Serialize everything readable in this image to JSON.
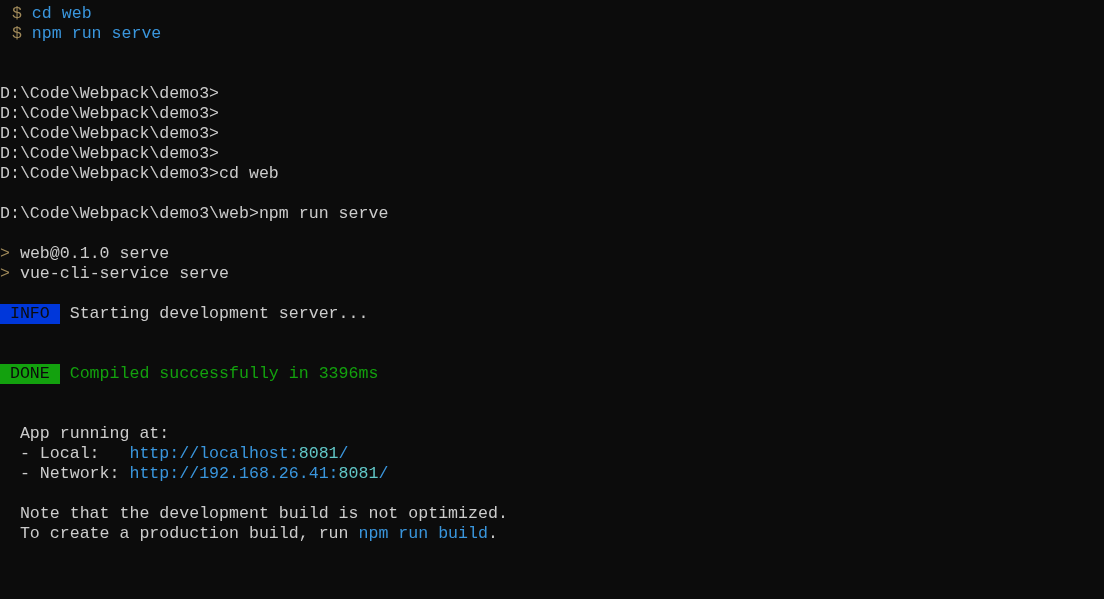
{
  "terminal": {
    "lines": [
      {
        "kind": "echo",
        "segments": [
          {
            "kind": "marker",
            "text": "$"
          },
          {
            "kind": "command",
            "text": "cd web"
          }
        ]
      },
      {
        "kind": "echo",
        "segments": [
          {
            "kind": "marker",
            "text": "$"
          },
          {
            "kind": "command",
            "text": "npm run serve"
          }
        ]
      },
      {
        "kind": "blank"
      },
      {
        "kind": "blank"
      },
      {
        "kind": "output",
        "segments": [
          {
            "kind": "plain",
            "text": "D:\\Code\\Webpack\\demo3>"
          }
        ]
      },
      {
        "kind": "output",
        "segments": [
          {
            "kind": "plain",
            "text": "D:\\Code\\Webpack\\demo3>"
          }
        ]
      },
      {
        "kind": "output",
        "segments": [
          {
            "kind": "plain",
            "text": "D:\\Code\\Webpack\\demo3>"
          }
        ]
      },
      {
        "kind": "output",
        "segments": [
          {
            "kind": "plain",
            "text": "D:\\Code\\Webpack\\demo3>"
          }
        ]
      },
      {
        "kind": "output",
        "segments": [
          {
            "kind": "plain",
            "text": "D:\\Code\\Webpack\\demo3>cd web"
          }
        ]
      },
      {
        "kind": "blank"
      },
      {
        "kind": "output",
        "segments": [
          {
            "kind": "plain",
            "text": "D:\\Code\\Webpack\\demo3\\web>npm run serve"
          }
        ]
      },
      {
        "kind": "blank"
      },
      {
        "kind": "output",
        "segments": [
          {
            "kind": "marker",
            "text": ">"
          },
          {
            "kind": "plain",
            "text": "web@0.1.0 serve"
          }
        ]
      },
      {
        "kind": "output",
        "segments": [
          {
            "kind": "marker",
            "text": ">"
          },
          {
            "kind": "plain",
            "text": "vue-cli-service serve"
          }
        ]
      },
      {
        "kind": "blank"
      },
      {
        "kind": "output",
        "segments": [
          {
            "kind": "info",
            "text": "INFO"
          },
          {
            "kind": "plain",
            "text": "Starting development server..."
          }
        ]
      },
      {
        "kind": "blank"
      },
      {
        "kind": "blank"
      },
      {
        "kind": "output",
        "segments": [
          {
            "kind": "done",
            "text": "DONE"
          },
          {
            "kind": "success",
            "text": "Compiled successfully in 3396ms"
          }
        ]
      },
      {
        "kind": "blank"
      },
      {
        "kind": "blank"
      },
      {
        "kind": "indented",
        "segments": [
          {
            "kind": "plain",
            "text": "App running at:"
          }
        ]
      },
      {
        "kind": "indented",
        "segments": [
          {
            "kind": "label",
            "text": "- Local:"
          },
          {
            "kind": "link",
            "pieces": [
              {
                "kind": "host",
                "text": "http://localhost:"
              },
              {
                "kind": "port",
                "text": "8081"
              },
              {
                "kind": "host",
                "text": "/"
              }
            ]
          }
        ]
      },
      {
        "kind": "indented",
        "segments": [
          {
            "kind": "label",
            "text": "- Network:"
          },
          {
            "kind": "link",
            "pieces": [
              {
                "kind": "host",
                "text": "http://192.168.26.41:"
              },
              {
                "kind": "port",
                "text": "8081"
              },
              {
                "kind": "host",
                "text": "/"
              }
            ]
          }
        ]
      },
      {
        "kind": "blank"
      },
      {
        "kind": "indented",
        "segments": [
          {
            "kind": "plain",
            "text": "Note that the development build is not optimized."
          }
        ]
      },
      {
        "kind": "indented",
        "segments": [
          {
            "kind": "sentence",
            "pieces": [
              {
                "kind": "plain",
                "text": "To create a production build, run "
              },
              {
                "kind": "command",
                "text": "npm run build"
              },
              {
                "kind": "plain",
                "text": "."
              }
            ]
          }
        ]
      }
    ]
  }
}
